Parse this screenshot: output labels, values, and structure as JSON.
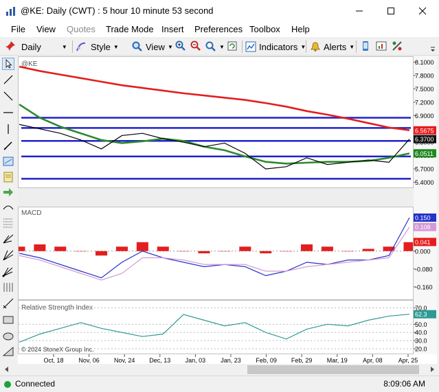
{
  "window": {
    "title": "@KE: Daily (CWT) : 5 hour 10 minute 53 second"
  },
  "menu": [
    "File",
    "View",
    "Quotes",
    "Trade Mode",
    "Insert",
    "Preferences",
    "Toolbox",
    "Help"
  ],
  "toolbar": {
    "interval": "Daily",
    "style": "Style",
    "view": "View",
    "indicators": "Indicators",
    "alerts": "Alerts"
  },
  "chart_data": [
    {
      "type": "line",
      "title": "@KE",
      "x_ticks": [
        "Oct, 18",
        "Nov, 06",
        "Nov, 24",
        "Dec, 13",
        "Jan, 03",
        "Jan, 23",
        "Feb, 09",
        "Feb, 29",
        "Mar, 19",
        "Apr, 08",
        "Apr, 25"
      ],
      "y_ticks": [
        8.1,
        7.8,
        7.5,
        7.2,
        6.9,
        6.6,
        6.3,
        6.0,
        5.7,
        5.4
      ],
      "ylim": [
        5.3,
        8.2
      ],
      "price_labels": [
        "6.5675",
        "6.3700",
        "6.0511"
      ],
      "price_label_colors": [
        "#e81b1b",
        "#111111",
        "#1e8a1e"
      ],
      "hlines": [
        6.85,
        6.62,
        6.33,
        5.98,
        5.48
      ],
      "series": [
        {
          "values": [
            8.0,
            7.9,
            7.82,
            7.74,
            7.66,
            7.58,
            7.52,
            7.46,
            7.4,
            7.35,
            7.3,
            7.25,
            7.18,
            7.1,
            7.0,
            6.92,
            6.83,
            6.73,
            6.63,
            6.57
          ],
          "color": "#e31e1e"
        },
        {
          "values": [
            7.15,
            6.85,
            6.65,
            6.5,
            6.35,
            6.28,
            6.32,
            6.38,
            6.33,
            6.2,
            6.12,
            5.98,
            5.86,
            5.82,
            5.84,
            5.86,
            5.86,
            5.88,
            5.95,
            6.05
          ],
          "color": "#2d8a2d"
        },
        {
          "values": [
            6.7,
            6.6,
            6.5,
            6.35,
            6.15,
            6.45,
            6.5,
            6.38,
            6.3,
            6.2,
            6.28,
            6.05,
            5.7,
            5.75,
            5.95,
            5.8,
            5.85,
            5.9,
            5.85,
            6.37
          ],
          "color": "#000000"
        }
      ],
      "watermark": "© 2024 StoneX Group Inc."
    },
    {
      "type": "bar",
      "title": "MACD",
      "y_ticks": [
        0.0,
        -0.08,
        -0.16
      ],
      "ylim": [
        -0.21,
        0.19
      ],
      "value_labels": [
        "0.150",
        "0.108",
        "0.041"
      ],
      "value_label_colors": [
        "#2433c9",
        "#d39ad6",
        "#e81b1b"
      ],
      "series": [
        {
          "values": [
            0.02,
            0.03,
            0.02,
            0.0,
            -0.02,
            0.02,
            0.04,
            0.02,
            0.0,
            -0.01,
            0.0,
            0.02,
            -0.01,
            0.0,
            0.03,
            0.02,
            0.0,
            0.01,
            0.02,
            0.04
          ],
          "color": "#e31e1e"
        },
        {
          "values": [
            -0.01,
            -0.03,
            -0.06,
            -0.09,
            -0.12,
            -0.05,
            0.0,
            -0.03,
            -0.05,
            -0.07,
            -0.06,
            -0.07,
            -0.11,
            -0.09,
            -0.05,
            -0.06,
            -0.04,
            -0.04,
            -0.02,
            0.15
          ],
          "color": "#2433c9"
        },
        {
          "values": [
            -0.02,
            -0.04,
            -0.07,
            -0.1,
            -0.13,
            -0.1,
            -0.03,
            -0.03,
            -0.04,
            -0.06,
            -0.06,
            -0.06,
            -0.09,
            -0.09,
            -0.07,
            -0.06,
            -0.05,
            -0.04,
            -0.03,
            0.108
          ],
          "color": "#d39ad6"
        }
      ]
    },
    {
      "type": "line",
      "title": "Relative Strength Index",
      "y_ticks": [
        70.0,
        50.0,
        40.0,
        30.0,
        20.0
      ],
      "ylim": [
        15,
        78
      ],
      "value_labels": [
        "62.3"
      ],
      "value_label_colors": [
        "#2e9a93"
      ],
      "series": [
        {
          "values": [
            28,
            38,
            45,
            52,
            45,
            40,
            35,
            38,
            62,
            55,
            48,
            52,
            40,
            32,
            44,
            50,
            48,
            55,
            60,
            62.3
          ],
          "color": "#2e9a93"
        }
      ]
    }
  ],
  "status": {
    "text": "Connected",
    "time": "8:09:06 AM"
  }
}
